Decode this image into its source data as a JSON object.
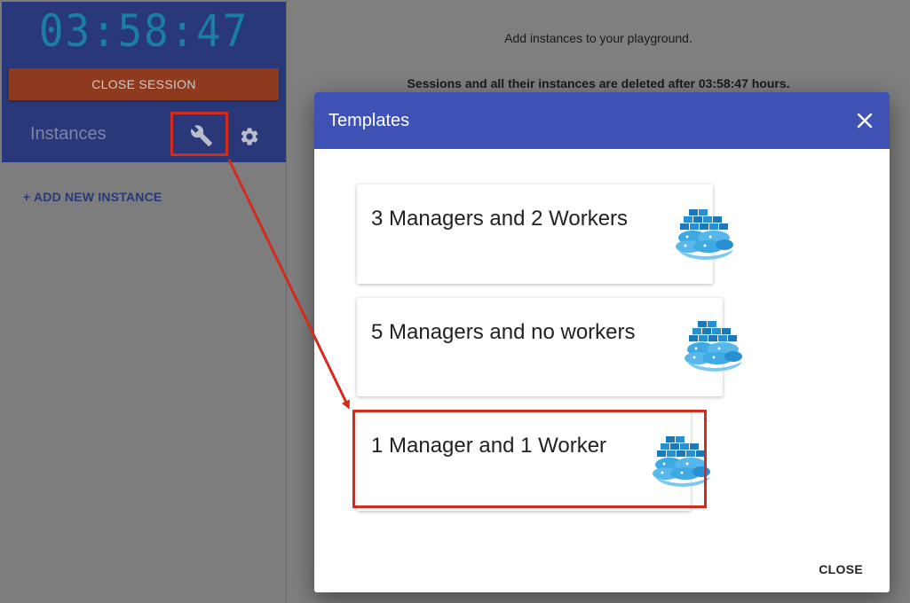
{
  "sidebar": {
    "timer": "03:58:47",
    "close_session_label": "CLOSE SESSION",
    "instances_title": "Instances",
    "wrench_icon": "wrench-icon",
    "gear_icon": "gear-icon",
    "add_instance_label": "+ ADD NEW INSTANCE"
  },
  "main": {
    "message": "Add instances to your playground.",
    "session_note": "Sessions and all their instances are deleted after 03:58:47 hours."
  },
  "dialog": {
    "title": "Templates",
    "close_icon": "close-icon",
    "templates": [
      {
        "label": "3 Managers and 2 Workers",
        "icon": "docker-whale-icon"
      },
      {
        "label": "5 Managers and no workers",
        "icon": "docker-whale-icon"
      },
      {
        "label": "1 Manager and 1 Worker",
        "icon": "docker-whale-icon"
      }
    ],
    "close_label": "CLOSE"
  },
  "colors": {
    "sidebar_header": "#283879",
    "timer": "#1a7fa1",
    "close_session": "#8e3a1e",
    "dialog_header": "#3f51b5",
    "annotation": "#d42b1e"
  }
}
